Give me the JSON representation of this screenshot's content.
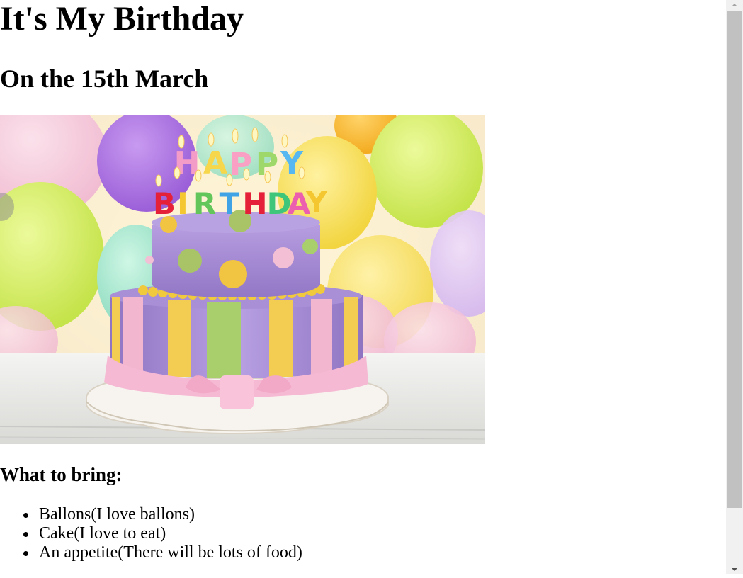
{
  "page": {
    "title": "It's My Birthday",
    "subtitle": "On the 15th March",
    "photo_alt": "Birthday cake with Happy Birthday candles in front of colorful balloons",
    "photo_candle_text_top": "HAPPY",
    "photo_candle_text_bottom": "BIRTHDAY",
    "bring_heading": "What to bring:",
    "bring_items": [
      "Ballons(I love ballons)",
      "Cake(I love to eat)",
      "An appetite(There will be lots of food)"
    ]
  },
  "colors": {
    "text": "#000000",
    "scrollbar_track": "#f1f1f1",
    "scrollbar_thumb": "#c1c1c1",
    "cake_purple": "#a98fd0",
    "cake_pink": "#f2b6cf",
    "cake_yellow": "#f3cc52",
    "cake_green": "#a9cf6d"
  },
  "icons": {
    "scroll_up": "scroll-up-arrow-icon",
    "scroll_down": "scroll-down-arrow-icon"
  }
}
